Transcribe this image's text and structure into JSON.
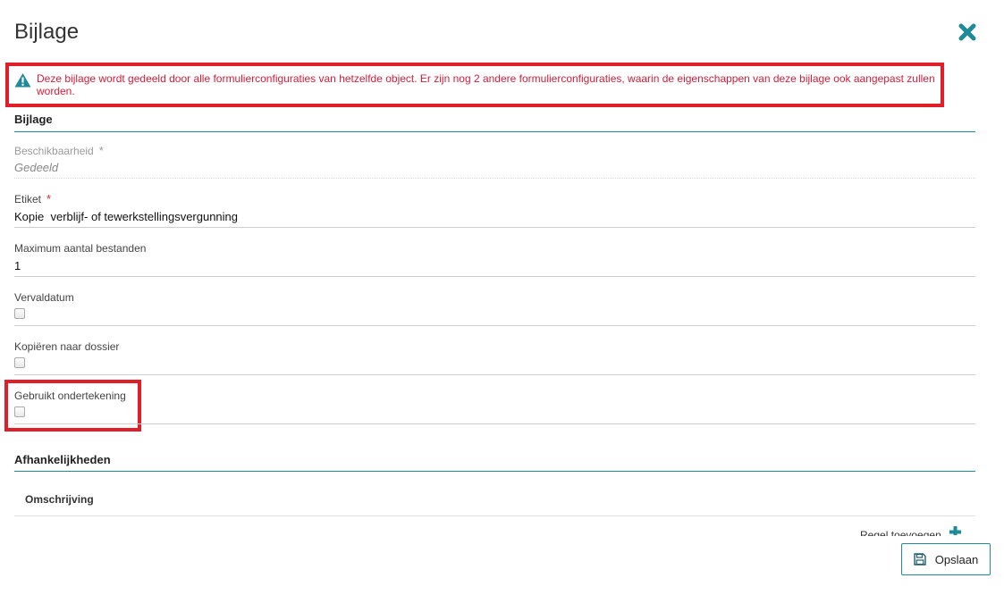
{
  "dialog": {
    "title": "Bijlage",
    "close_icon": "close-x-icon",
    "accent_color": "#1f8a98"
  },
  "warning": {
    "icon": "warning-triangle-icon",
    "text": "Deze bijlage wordt gedeeld door alle formulierconfiguraties van hetzelfde object. Er zijn nog 2 andere formulierconfiguraties, waarin de eigenschappen van deze bijlage ook aangepast zullen worden.",
    "color": "#d1203a"
  },
  "section_bijlage": {
    "title": "Bijlage",
    "fields": {
      "beschikbaarheid": {
        "label": "Beschikbaarheid",
        "required_mark": "*",
        "value": "Gedeeld"
      },
      "etiket": {
        "label": "Etiket",
        "required_mark": "*",
        "value": "Kopie  verblijf- of tewerkstellingsvergunning"
      },
      "max_files": {
        "label": "Maximum aantal bestanden",
        "value": "1"
      },
      "vervaldatum": {
        "label": "Vervaldatum",
        "checked": false
      },
      "kopieren": {
        "label": "Kopiëren naar dossier",
        "checked": false
      },
      "ondertekening": {
        "label": "Gebruikt ondertekening",
        "checked": false
      }
    }
  },
  "section_afhankelijkheden": {
    "title": "Afhankelijkheden",
    "columns": [
      "Omschrijving"
    ],
    "add_rule_label": "Regel toevoegen",
    "add_icon": "plus-icon"
  },
  "footer": {
    "save_label": "Opslaan",
    "save_icon": "floppy-disk-icon"
  }
}
